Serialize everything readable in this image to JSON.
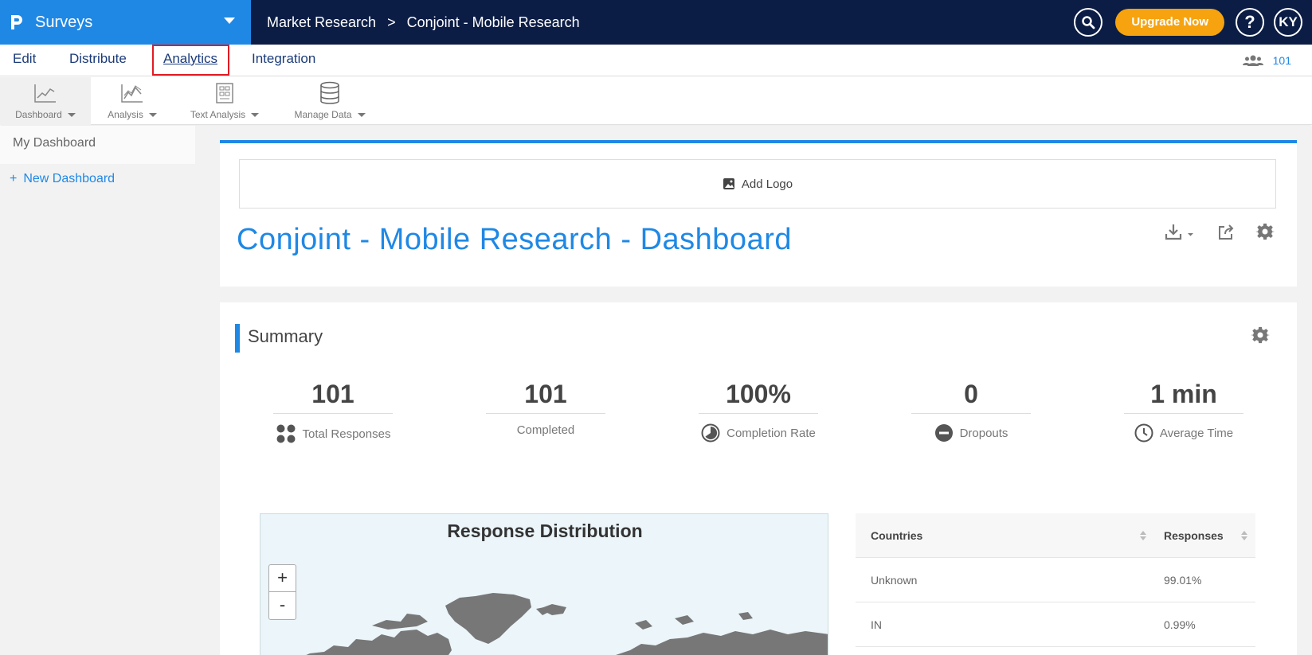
{
  "app": {
    "name": "Surveys"
  },
  "breadcrumb": {
    "parent": "Market Research",
    "separator": ">",
    "current": "Conjoint - Mobile Research"
  },
  "header": {
    "upgrade_label": "Upgrade Now",
    "help_label": "?",
    "avatar_initials": "KY"
  },
  "tabs": [
    {
      "label": "Edit"
    },
    {
      "label": "Distribute"
    },
    {
      "label": "Analytics"
    },
    {
      "label": "Integration"
    }
  ],
  "active_tab": "Analytics",
  "response_count": "101",
  "toolbar": [
    {
      "label": "Dashboard",
      "icon": "line-chart-icon"
    },
    {
      "label": "Analysis",
      "icon": "analysis-chart-icon"
    },
    {
      "label": "Text Analysis",
      "icon": "text-analysis-icon"
    },
    {
      "label": "Manage Data",
      "icon": "database-icon"
    }
  ],
  "sidebar": {
    "items": [
      {
        "label": "My Dashboard"
      }
    ],
    "new_dashboard_label": "New Dashboard",
    "new_dashboard_prefix": "+"
  },
  "dashboard": {
    "add_logo_label": "Add Logo",
    "title": "Conjoint - Mobile Research - Dashboard"
  },
  "summary": {
    "title": "Summary",
    "stats": [
      {
        "value": "101",
        "label": "Total Responses",
        "icon": "dots-icon"
      },
      {
        "value": "101",
        "label": "Completed",
        "icon": ""
      },
      {
        "value": "100%",
        "label": "Completion Rate",
        "icon": "pie-icon"
      },
      {
        "value": "0",
        "label": "Dropouts",
        "icon": "minus-circle-icon"
      },
      {
        "value": "1 min",
        "label": "Average Time",
        "icon": "clock-icon"
      }
    ]
  },
  "map": {
    "title": "Response Distribution",
    "zoom_in": "+",
    "zoom_out": "-"
  },
  "country_table": {
    "headers": [
      "Countries",
      "Responses"
    ],
    "rows": [
      {
        "country": "Unknown",
        "responses": "99.01%"
      },
      {
        "country": "IN",
        "responses": "0.99%"
      }
    ]
  },
  "colors": {
    "brand_blue": "#1f88e5",
    "navy": "#0b1d45",
    "upgrade_orange": "#f6a30f",
    "highlight_red": "#e21b23"
  }
}
